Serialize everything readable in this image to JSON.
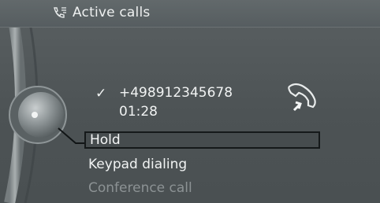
{
  "header": {
    "title": "Active calls",
    "icon": "phone-list-icon"
  },
  "call": {
    "status_icon": "check-icon",
    "check_symbol": "✓",
    "number": "+498912345678",
    "duration": "01:28",
    "end_call_icon": "hang-up-phone-icon"
  },
  "menu": {
    "items": [
      {
        "label": "Hold",
        "selected": true
      },
      {
        "label": "Keypad dialing",
        "selected": false
      },
      {
        "label": "Conference call",
        "selected": false,
        "disabled": true
      }
    ]
  },
  "colors": {
    "text": "#f1f3f3",
    "disabled_text": "#8c9294",
    "selection_border": "#15191a"
  }
}
